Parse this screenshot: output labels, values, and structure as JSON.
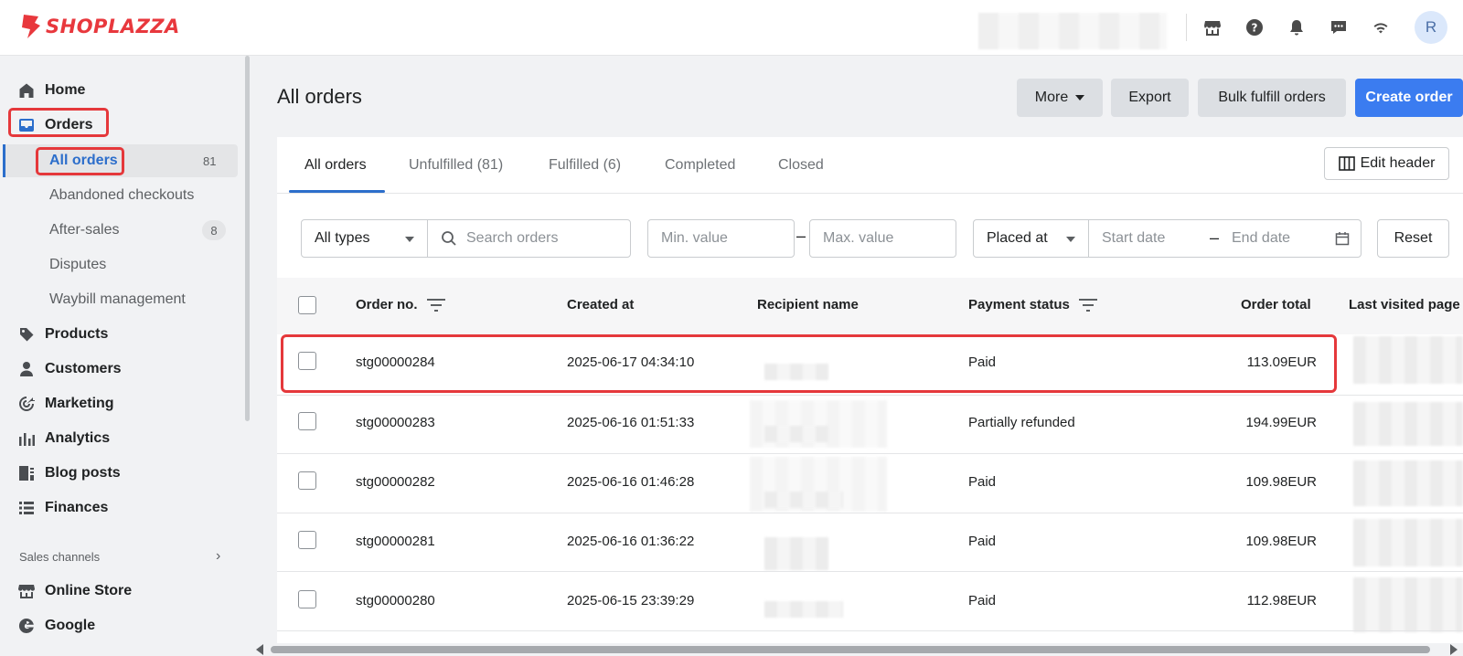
{
  "brand": {
    "name": "SHOPLAZZA",
    "color": "#e8383d"
  },
  "topbar": {
    "icons": [
      "store-icon",
      "help-icon",
      "bell-icon",
      "chat-icon",
      "wifi-icon"
    ],
    "avatar_initial": "R"
  },
  "sidebar": {
    "items": [
      {
        "label": "Home",
        "icon": "home-icon"
      },
      {
        "label": "Orders",
        "icon": "inbox-icon"
      },
      {
        "label": "Products",
        "icon": "tag-icon"
      },
      {
        "label": "Customers",
        "icon": "person-icon"
      },
      {
        "label": "Marketing",
        "icon": "target-icon"
      },
      {
        "label": "Analytics",
        "icon": "bar-chart-icon"
      },
      {
        "label": "Blog posts",
        "icon": "document-icon"
      },
      {
        "label": "Finances",
        "icon": "list-icon"
      }
    ],
    "orders_sub": [
      {
        "label": "All orders",
        "count": "81"
      },
      {
        "label": "Abandoned checkouts"
      },
      {
        "label": "After-sales",
        "count": "8"
      },
      {
        "label": "Disputes"
      },
      {
        "label": "Waybill management"
      }
    ],
    "sales_channels_label": "Sales channels",
    "channels": [
      {
        "label": "Online Store",
        "icon": "store-icon"
      },
      {
        "label": "Google",
        "icon": "google-icon"
      }
    ]
  },
  "header": {
    "title": "All orders",
    "more_label": "More",
    "export_label": "Export",
    "bulk_label": "Bulk fulfill orders",
    "create_label": "Create order"
  },
  "tabs": [
    "All orders",
    "Unfulfilled (81)",
    "Fulfilled (6)",
    "Completed",
    "Closed"
  ],
  "edit_header_label": "Edit header",
  "filters": {
    "type_value": "All types",
    "search_placeholder": "Search orders",
    "min_placeholder": "Min. value",
    "max_placeholder": "Max. value",
    "date_type_value": "Placed at",
    "start_placeholder": "Start date",
    "end_placeholder": "End date",
    "reset_label": "Reset"
  },
  "table": {
    "columns": [
      "Order no.",
      "Created at",
      "Recipient name",
      "Payment status",
      "Order total",
      "Last visited page"
    ],
    "rows": [
      {
        "order_no": "stg00000284",
        "created_at": "2025-06-17 04:34:10",
        "payment_status": "Paid",
        "total": "113.09EUR"
      },
      {
        "order_no": "stg00000283",
        "created_at": "2025-06-16 01:51:33",
        "payment_status": "Partially refunded",
        "total": "194.99EUR"
      },
      {
        "order_no": "stg00000282",
        "created_at": "2025-06-16 01:46:28",
        "payment_status": "Paid",
        "total": "109.98EUR"
      },
      {
        "order_no": "stg00000281",
        "created_at": "2025-06-16 01:36:22",
        "payment_status": "Paid",
        "total": "109.98EUR"
      },
      {
        "order_no": "stg00000280",
        "created_at": "2025-06-15 23:39:29",
        "payment_status": "Paid",
        "total": "112.98EUR"
      }
    ]
  },
  "colors": {
    "accent": "#2c6ecb",
    "primary_button": "#3b7cf0",
    "highlight": "#e5383b"
  }
}
